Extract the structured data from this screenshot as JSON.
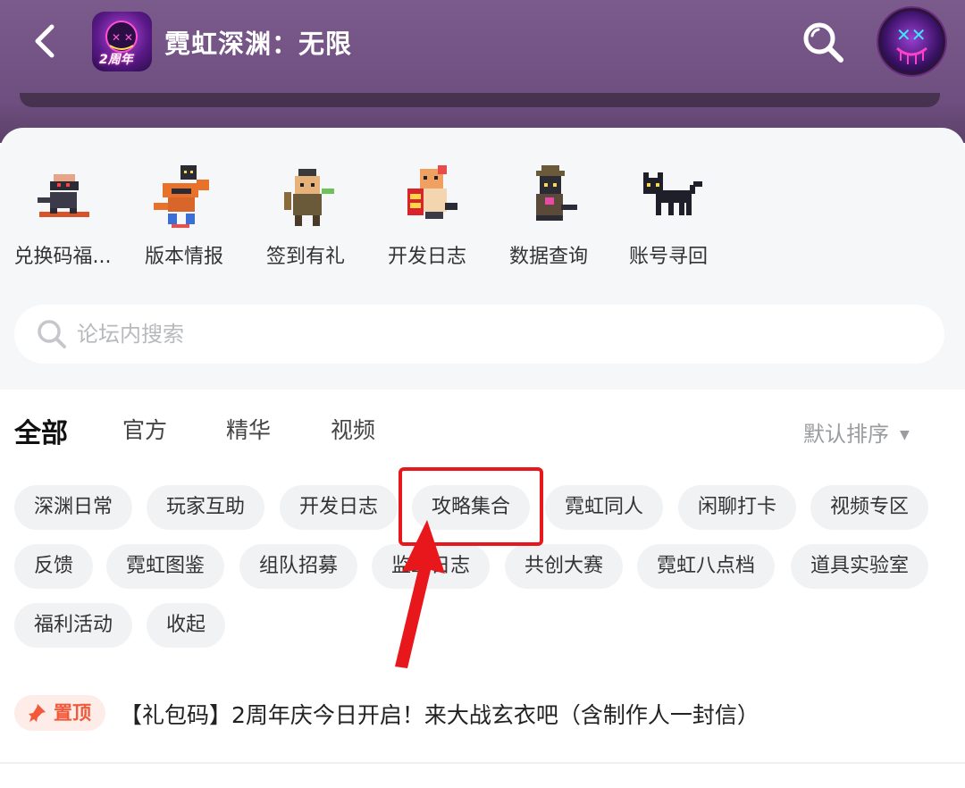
{
  "header": {
    "title": "霓虹深渊：无限",
    "app_icon_badge": "2周年",
    "icons": [
      "back-arrow-icon",
      "search-icon",
      "avatar"
    ]
  },
  "shortcuts": [
    {
      "label": "兑换码福..."
    },
    {
      "label": "版本情报"
    },
    {
      "label": "签到有礼"
    },
    {
      "label": "开发日志"
    },
    {
      "label": "数据查询"
    },
    {
      "label": "账号寻回"
    }
  ],
  "search": {
    "placeholder": "论坛内搜索",
    "value": ""
  },
  "tabs": {
    "items": [
      "全部",
      "官方",
      "精华",
      "视频"
    ],
    "active": "全部",
    "sort_label": "默认排序"
  },
  "chips": [
    "深渊日常",
    "玩家互助",
    "开发日志",
    "攻略集合",
    "霓虹同人",
    "闲聊打卡",
    "视频专区",
    "反馈",
    "霓虹图鉴",
    "组队招募",
    "监工日志",
    "共创大赛",
    "霓虹八点档",
    "道具实验室",
    "福利活动",
    "收起"
  ],
  "highlighted_chip": "攻略集合",
  "pinned_post": {
    "badge": "置顶",
    "title": "【礼包码】2周年庆今日开启！来大战玄衣吧（含制作人一封信）"
  },
  "colors": {
    "header_bg": "#735485",
    "tab_accent": "#37d7c0",
    "highlight_red": "#e8171c",
    "pin_orange": "#f2593a"
  }
}
